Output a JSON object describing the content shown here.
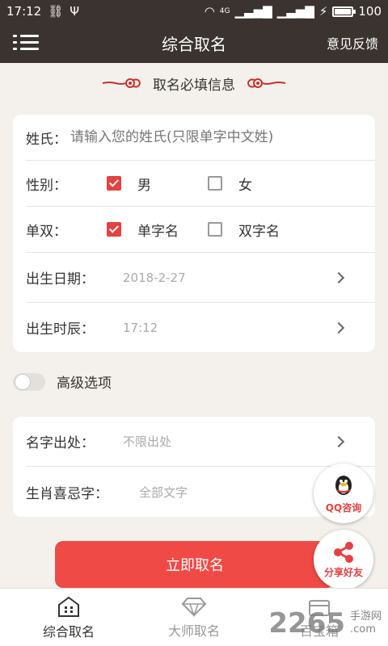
{
  "status_bar": {
    "time": "17:12",
    "battery": "100",
    "network": "4G",
    "battery_level": 1.0
  },
  "header": {
    "title": "综合取名",
    "feedback": "意见反馈"
  },
  "section_title": "取名必填信息",
  "form": {
    "surname_label": "姓氏",
    "surname_colon": "：",
    "surname_placeholder": "请输入您的姓氏(只限单字中文姓)",
    "gender_label": "性别：",
    "gender_male": "男",
    "gender_female": "女",
    "single_double_label": "单双：",
    "single_option": "单字名",
    "double_option": "双字名",
    "birth_date_label": "出生日期：",
    "birth_date_value": "2018-2-27",
    "birth_hour_label": "出生时辰：",
    "birth_hour_value": "17:12"
  },
  "advanced": {
    "label": "高级选项"
  },
  "advanced_form": {
    "origin_label": "名字出处：",
    "origin_value": "不限出处",
    "zodiac_label": "生肖喜忌字：",
    "zodiac_value": "全部文字"
  },
  "submit_label": "立即取名",
  "floating": {
    "qq_label": "QQ咨询",
    "share_label": "分享好友"
  },
  "tabs": [
    {
      "label": "综合取名",
      "icon": "house-icon"
    },
    {
      "label": "大师取名",
      "icon": "diamond-icon"
    },
    {
      "label": "百宝箱",
      "icon": "box-icon"
    }
  ],
  "watermark": {
    "brand": "2265",
    "sub1": "手游网",
    "sub2": ".com"
  },
  "colors": {
    "header_bg": "#3a3330",
    "accent": "#e44141",
    "cta": "#ef4a45"
  }
}
